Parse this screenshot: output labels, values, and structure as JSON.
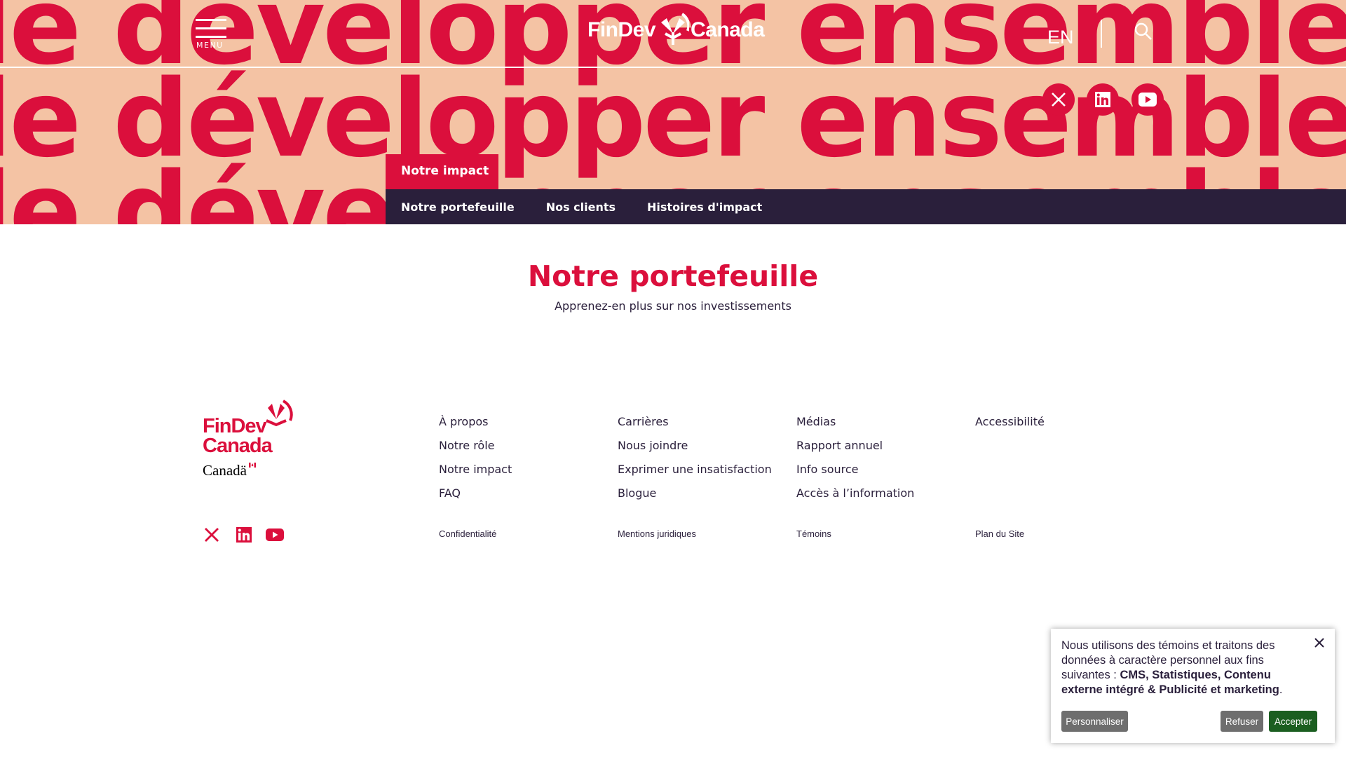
{
  "hero": {
    "background_phrase": "le développer ensemble de",
    "colors": {
      "background": "#f4c3a4",
      "text": "#db0f3c"
    }
  },
  "header": {
    "menu_label": "MENU",
    "logo_left": "FinDev",
    "logo_right": "Canada",
    "language": "EN",
    "social": [
      "x-icon",
      "linkedin-icon",
      "youtube-icon"
    ]
  },
  "section_tab": "Notre impact",
  "subnav": {
    "items": [
      {
        "label": "Notre portefeuille"
      },
      {
        "label": "Nos clients"
      },
      {
        "label": "Histoires d'impact"
      }
    ]
  },
  "main": {
    "title": "Notre portefeuille",
    "subtitle": "Apprenez-en plus sur nos investissements"
  },
  "footer": {
    "logo_line1": "FinDev",
    "logo_line2": "Canada",
    "canada_wordmark": "Canadä",
    "columns": [
      [
        "À propos",
        "Notre rôle",
        "Notre impact",
        "FAQ"
      ],
      [
        "Carrières",
        "Nous joindre",
        "Exprimer une insatisfaction",
        "Blogue"
      ],
      [
        "Médias",
        "Rapport annuel",
        "Info source",
        "Accès à l’information"
      ],
      [
        "Accessibilité"
      ]
    ],
    "legal": [
      "Confidentialité",
      "Mentions juridiques",
      "Témoins",
      "Plan du Site"
    ]
  },
  "cookie": {
    "text_intro": "Nous utilisons des témoins et traitons des données à caractère personnel aux fins suivantes :",
    "text_bold": "CMS, Statistiques, Contenu externe intégré & Publicité et marketing",
    "text_end": ".",
    "btn_personalize": "Personnaliser",
    "btn_refuse": "Refuser",
    "btn_accept": "Accepter"
  },
  "colors": {
    "brand_red": "#db0f3c",
    "navy": "#2a1f3b",
    "accept_green": "#1b5e20",
    "button_gray": "#6e6e6e"
  }
}
